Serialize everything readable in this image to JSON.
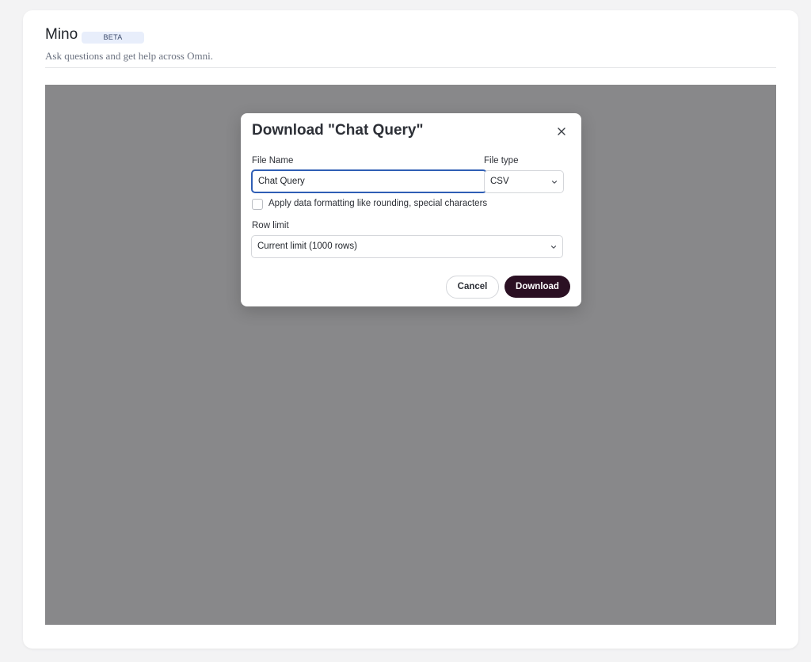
{
  "header": {
    "app_title": "Mino",
    "badge": "BETA",
    "subtitle": "Ask questions and get help across Omni."
  },
  "dialog": {
    "title": "Download \"Chat Query\"",
    "file_name_label": "File Name",
    "file_name_value": "Chat Query",
    "file_type_label": "File type",
    "file_type_value": "CSV",
    "format_checkbox_label": "Apply data formatting like rounding, special characters",
    "format_checkbox_checked": false,
    "row_limit_label": "Row limit",
    "row_limit_value": "Current limit (1000 rows)",
    "cancel_label": "Cancel",
    "download_label": "Download"
  },
  "icons": {
    "close": "close-icon",
    "file_type_chevron": "chevron-down-icon",
    "row_limit_chevron": "chevron-down-icon"
  },
  "colors": {
    "overlay": "#88888a",
    "primary_button": "#2b1023",
    "input_focus": "#2f5eb5",
    "badge_bg": "#e8eefb"
  }
}
